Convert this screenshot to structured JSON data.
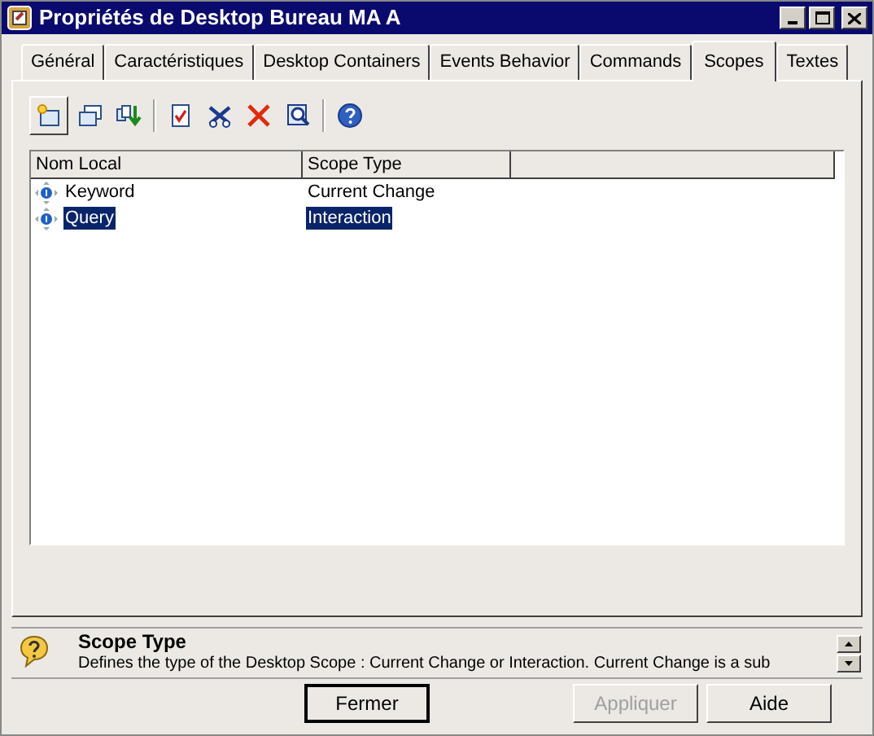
{
  "window": {
    "title": "Propriétés de Desktop Bureau MA A"
  },
  "tabs": [
    {
      "label": "Général",
      "selected": false
    },
    {
      "label": "Caractéristiques",
      "selected": false
    },
    {
      "label": "Desktop Containers",
      "selected": false
    },
    {
      "label": "Events Behavior",
      "selected": false
    },
    {
      "label": "Commands",
      "selected": false
    },
    {
      "label": "Scopes",
      "selected": true
    },
    {
      "label": "Textes",
      "selected": false
    }
  ],
  "toolbar": [
    {
      "kind": "new",
      "pressed": true
    },
    {
      "kind": "add",
      "pressed": false
    },
    {
      "kind": "reorder",
      "pressed": false
    },
    {
      "kind": "sep"
    },
    {
      "kind": "check",
      "pressed": false
    },
    {
      "kind": "tools",
      "pressed": false
    },
    {
      "kind": "delete",
      "pressed": false
    },
    {
      "kind": "find",
      "pressed": false
    },
    {
      "kind": "sep"
    },
    {
      "kind": "help",
      "pressed": false
    }
  ],
  "table": {
    "columns": [
      "Nom Local",
      "Scope Type"
    ],
    "rows": [
      {
        "cells": [
          "Keyword",
          "Current Change"
        ],
        "selected": false
      },
      {
        "cells": [
          "Query",
          "Interaction"
        ],
        "selected": true
      }
    ]
  },
  "help": {
    "title": "Scope Type",
    "text": "Defines the type of the Desktop Scope : Current Change or Interaction. Current Change is a sub"
  },
  "buttons": [
    {
      "label": "Fermer",
      "default": true,
      "disabled": false
    },
    {
      "label": "Appliquer",
      "default": false,
      "disabled": true
    },
    {
      "label": "Aide",
      "default": false,
      "disabled": false
    }
  ]
}
